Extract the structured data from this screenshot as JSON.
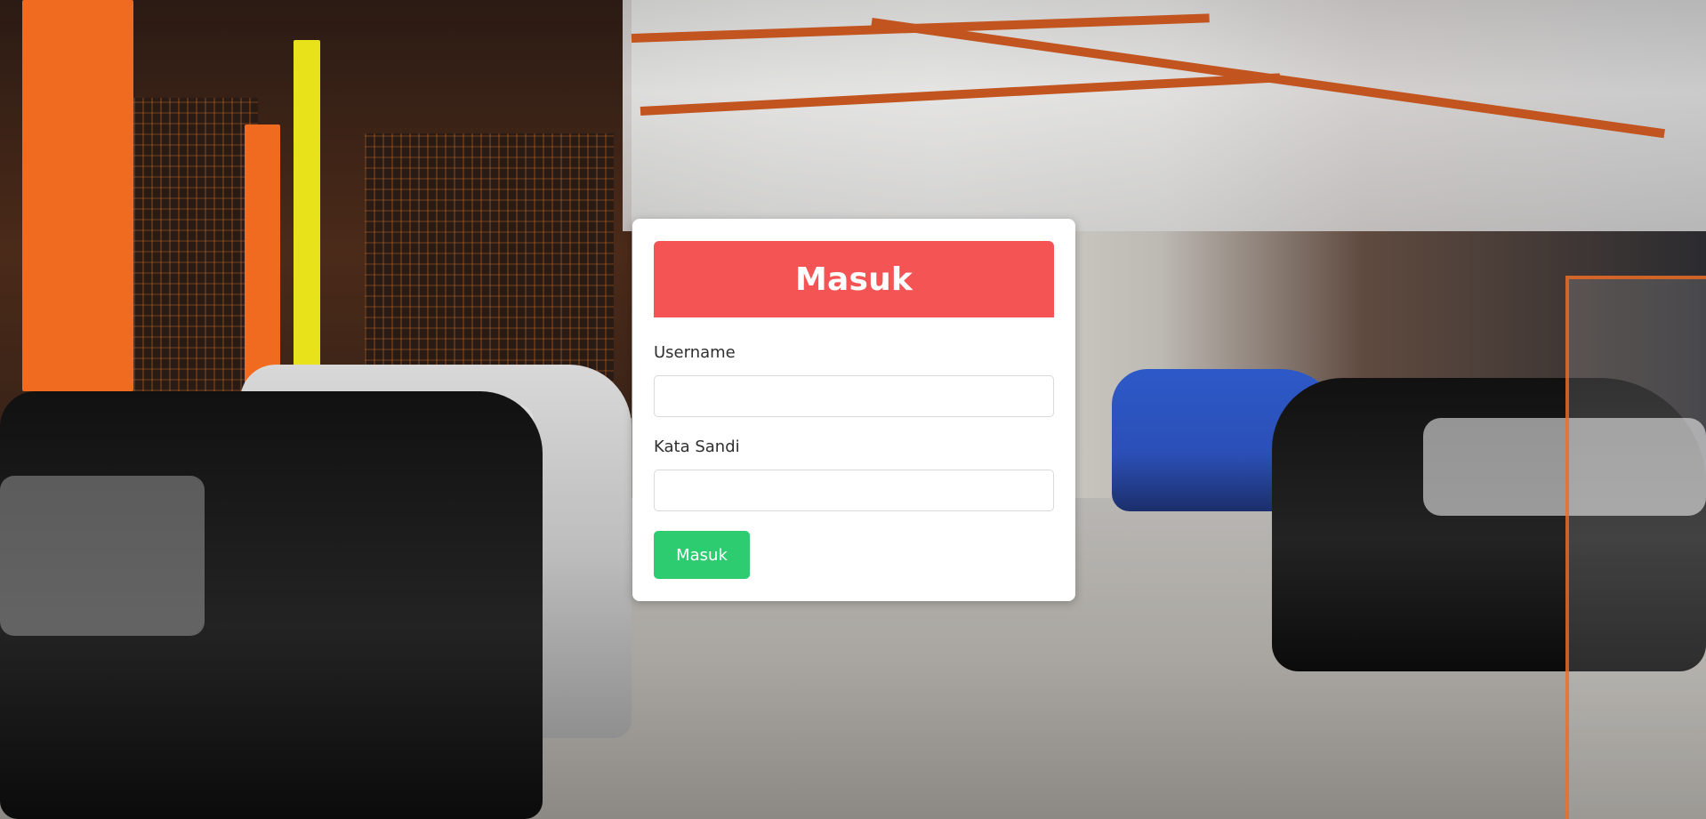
{
  "page": {
    "background_description": "",
    "background_colors": {
      "orange_structure": "#f06a1f",
      "floor": "#b9b7b3",
      "dark": "#1a1a1a"
    }
  },
  "login": {
    "title": "Masuk",
    "username_label": "Username",
    "username_value": "",
    "username_placeholder": "",
    "password_label": "Kata Sandi",
    "password_value": "",
    "password_placeholder": "",
    "submit_label": "Masuk"
  },
  "colors": {
    "header_bg": "#f55454",
    "button_bg": "#2ecc71",
    "card_bg": "#ffffff",
    "text": "#2f2f2f"
  }
}
